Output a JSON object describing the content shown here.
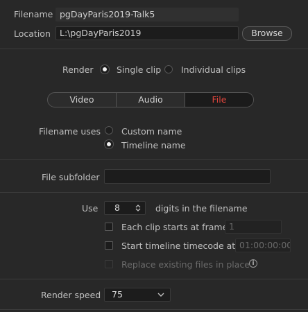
{
  "header": {
    "filename_label": "Filename",
    "filename_value": "pgDayParis2019-Talk5",
    "location_label": "Location",
    "location_value": "L:\\pgDayParis2019",
    "browse_label": "Browse"
  },
  "render_mode": {
    "label": "Render",
    "options": [
      "Single clip",
      "Individual clips"
    ],
    "selected": "Single clip"
  },
  "tabs": {
    "items": [
      "Video",
      "Audio",
      "File"
    ],
    "active": "File"
  },
  "filename_uses": {
    "label": "Filename uses",
    "options": [
      "Custom name",
      "Timeline name"
    ],
    "selected": "Timeline name"
  },
  "subfolder": {
    "label": "File subfolder",
    "value": ""
  },
  "digits": {
    "use_label": "Use",
    "value": "8",
    "suffix": "digits in the filename"
  },
  "options": {
    "each_clip_label": "Each clip starts at frame",
    "each_clip_value": "1",
    "start_tc_label": "Start timeline timecode at",
    "start_tc_value": "01:00:00:00",
    "replace_label": "Replace existing files in place",
    "info_icon": "info-icon"
  },
  "render_speed": {
    "label": "Render speed",
    "value": "75"
  },
  "colors": {
    "background": "#282828",
    "accent_active_tab": "#e0453c"
  }
}
